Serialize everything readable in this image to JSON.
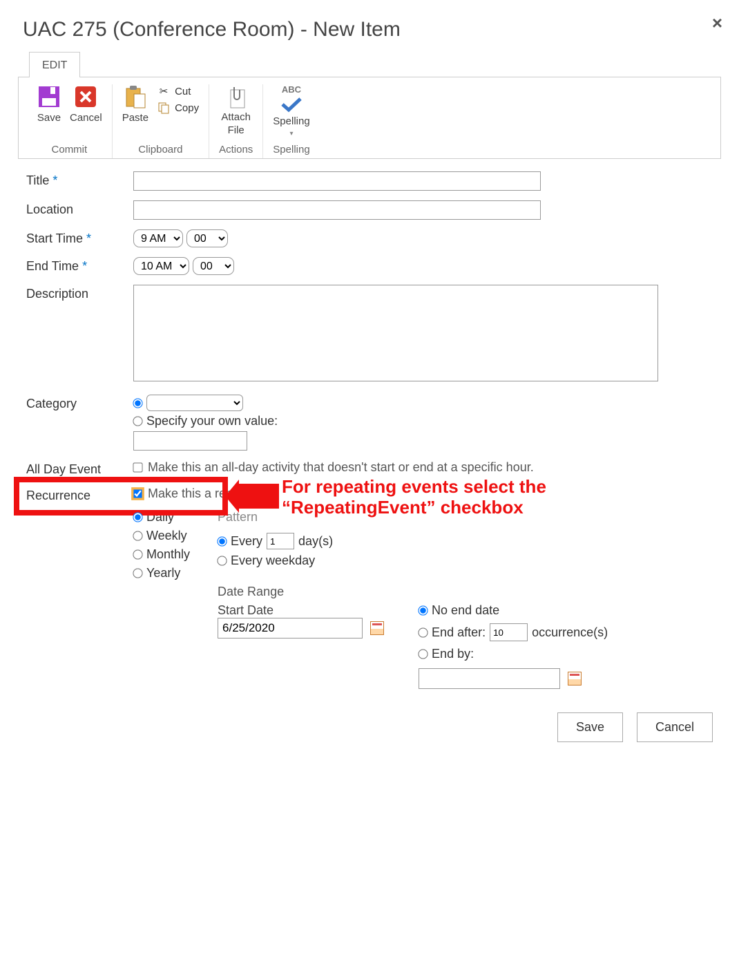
{
  "dialog": {
    "title": "UAC 275 (Conference Room) - New Item",
    "close": "×"
  },
  "tabs": {
    "edit": "EDIT"
  },
  "ribbon": {
    "save": "Save",
    "cancel": "Cancel",
    "commit_group": "Commit",
    "paste": "Paste",
    "cut": "Cut",
    "copy": "Copy",
    "clipboard_group": "Clipboard",
    "attach_l1": "Attach",
    "attach_l2": "File",
    "actions_group": "Actions",
    "spelling": "Spelling",
    "spelling_abc": "ABC",
    "spelling_group": "Spelling"
  },
  "form": {
    "title_label": "Title",
    "location_label": "Location",
    "start_label": "Start Time",
    "end_label": "End Time",
    "desc_label": "Description",
    "category_label": "Category",
    "allday_label": "All Day Event",
    "recur_label": "Recurrence",
    "req": "*",
    "title_value": "",
    "location_value": "",
    "start_hour": "9 AM",
    "start_min": "00",
    "end_hour": "10 AM",
    "end_min": "00",
    "desc_value": "",
    "cat_specify": "Specify your own value:",
    "cat_own_value": "",
    "allday_text": "Make this an all-day activity that doesn't start or end at a specific hour.",
    "allday_checked": false,
    "recur_text": "Make this a repeating event.",
    "recur_checked": true
  },
  "pattern": {
    "header": "Pattern",
    "daily": "Daily",
    "weekly": "Weekly",
    "monthly": "Monthly",
    "yearly": "Yearly",
    "every": "Every",
    "every_n": "1",
    "days_suffix": "day(s)",
    "every_weekday": "Every weekday"
  },
  "daterange": {
    "header": "Date Range",
    "start_label": "Start Date",
    "start_value": "6/25/2020",
    "no_end": "No end date",
    "end_after": "End after:",
    "end_after_n": "10",
    "occurrences": "occurrence(s)",
    "end_by": "End by:",
    "end_by_value": ""
  },
  "buttons": {
    "save": "Save",
    "cancel": "Cancel"
  },
  "callout": {
    "text": "For repeating events select the “RepeatingEvent” checkbox"
  }
}
